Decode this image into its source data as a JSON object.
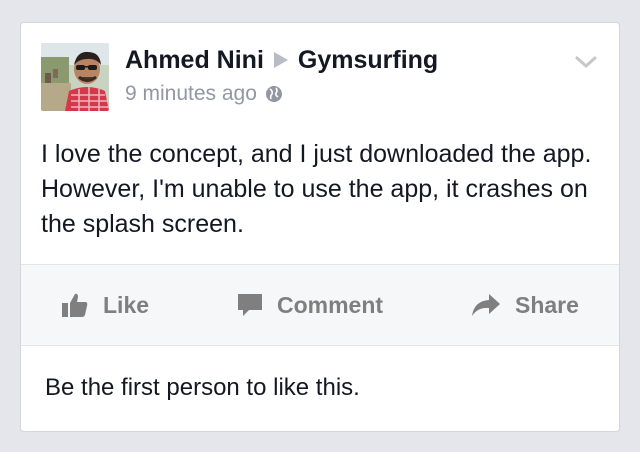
{
  "post": {
    "author": "Ahmed Nini",
    "target": "Gymsurfing",
    "timestamp": "9 minutes ago",
    "privacy_icon": "globe-icon",
    "options_icon": "chevron-down-icon",
    "body": "I love the concept, and I just downloaded the app. However, I'm unable to use the app, it crashes on the splash screen."
  },
  "actions": {
    "like_label": "Like",
    "comment_label": "Comment",
    "share_label": "Share"
  },
  "likes": {
    "summary": "Be the first person to like this."
  },
  "colors": {
    "background": "#e4e6eb",
    "card": "#ffffff",
    "primary_text": "#141823",
    "secondary_text": "#9197a3",
    "action_text": "#7f7f7f",
    "action_bar": "#f6f7f9"
  }
}
